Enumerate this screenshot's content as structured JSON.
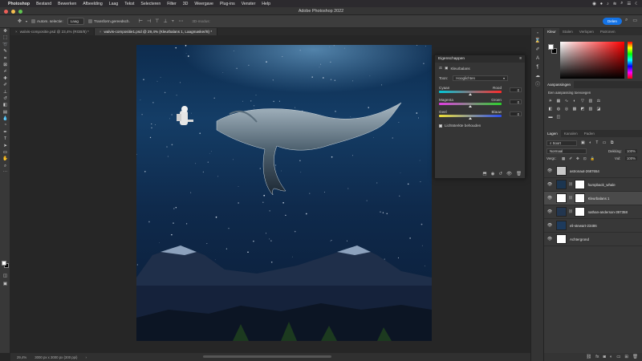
{
  "menubar": {
    "app": "Photoshop",
    "items": [
      "Bestand",
      "Bewerken",
      "Afbeelding",
      "Laag",
      "Tekst",
      "Selecteren",
      "Filter",
      "3D",
      "Weergave",
      "Plug-ins",
      "Venster",
      "Help"
    ]
  },
  "window": {
    "title": "Adobe Photoshop 2022"
  },
  "options": {
    "auto_select_label": "Autom. selectie:",
    "auto_select_target": "Laag",
    "transform_label": "Transform.gereedsch.",
    "share_label": "Delen",
    "mode3d_label": "3D-modus:"
  },
  "tabs": [
    {
      "label": "walvis-compositie.psd @ 23,4% (RGB/8) *",
      "active": false
    },
    {
      "label": "walvis-compositie1.psd @ 29,4% (Kleurbalans 1, Laagmasker/8) *",
      "active": true
    }
  ],
  "status": {
    "zoom": "29,4%",
    "doc_size": "3000 px x 3000 px (300 ppi)"
  },
  "properties": {
    "title": "Eigenschappen",
    "type_label": "Kleurbalans",
    "tone_label": "Toon:",
    "tone_value": "Hooglichten",
    "sliders": [
      {
        "left": "Cyaan",
        "right": "Rood",
        "value": "0",
        "position": 0.5
      },
      {
        "left": "Magenta",
        "right": "Groen",
        "value": "0",
        "position": 0.5
      },
      {
        "left": "Geel",
        "right": "Blauw",
        "value": "0",
        "position": 0.5
      }
    ],
    "preserve_label": "Lichtsterkte behouden"
  },
  "color_panel": {
    "tabs": [
      "Kleur",
      "Stalen",
      "Verlopen",
      "Patronen"
    ]
  },
  "adjust_panel": {
    "title": "Aanpassingen",
    "hint": "Een aanpassing toevoegen"
  },
  "layers_panel": {
    "tabs": [
      "Lagen",
      "Kanalen",
      "Paden"
    ],
    "filter_label": "Soort",
    "blend_mode": "Normaal",
    "opacity_label": "Dekking:",
    "opacity_value": "100%",
    "lock_label": "Vergr.:",
    "fill_label": "Vul:",
    "fill_value": "100%",
    "layers": [
      {
        "name": "astronaut-2687654",
        "thumb": "#c8c8c8",
        "mask": false,
        "selected": false
      },
      {
        "name": "humpback_whale",
        "thumb": "#1b3550",
        "mask": true,
        "selected": false
      },
      {
        "name": "Kleurbalans 1",
        "thumb": "#ffffff",
        "mask": true,
        "selected": true
      },
      {
        "name": "nathan-anderson-397358",
        "thumb": "#23364f",
        "mask": true,
        "selected": false
      },
      {
        "name": "eli-stewart-23486",
        "thumb": "#1d3a5c",
        "mask": false,
        "selected": false
      },
      {
        "name": "Achtergrond",
        "thumb": "#ffffff",
        "mask": false,
        "selected": false
      }
    ]
  }
}
